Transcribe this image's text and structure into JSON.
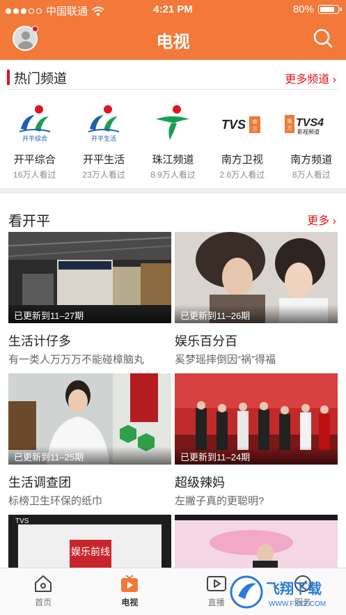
{
  "status": {
    "carrier": "中国联通",
    "time": "4:21 PM",
    "battery": "80%"
  },
  "header": {
    "title": "电视"
  },
  "hot": {
    "title": "热门频道",
    "more": "更多频道",
    "channels": [
      {
        "name": "开平综合",
        "views": "16万人看过",
        "logo_text": "开平综合",
        "icon": "kaiping-logo"
      },
      {
        "name": "开平生活",
        "views": "23万人看过",
        "logo_text": "开平生活",
        "icon": "kaiping-logo"
      },
      {
        "name": "珠江频道",
        "views": "8.9万人看过",
        "logo_text": "",
        "icon": "zhujiang-logo"
      },
      {
        "name": "南方卫视",
        "views": "2.6万人看过",
        "logo_text": "TVS",
        "logo_side": "南方",
        "icon": "tvs-logo"
      },
      {
        "name": "南方频道",
        "views": "8万人看过",
        "logo_text": "TVS4",
        "logo_side": "南方",
        "logo_sub": "影视频道",
        "icon": "tvs4-logo"
      }
    ]
  },
  "kaiping": {
    "title": "看开平",
    "more": "更多",
    "items": [
      {
        "update": "已更新到11–27期",
        "title": "生活计仔多",
        "subtitle": "有一类人万万万不能碰樟脑丸"
      },
      {
        "update": "已更新到11–26期",
        "title": "娱乐百分百",
        "subtitle": "奚梦瑶摔倒因“祸”得福"
      },
      {
        "update": "已更新到11–25期",
        "title": "生活调查团",
        "subtitle": "标榜卫生环保的纸巾"
      },
      {
        "update": "已更新到11–24期",
        "title": "超级辣妈",
        "subtitle": "左撇子真的更聪明?"
      }
    ],
    "partial_thumbs": [
      {
        "overlay_text": "娱乐前线",
        "corner_text": "TVS"
      },
      {
        "overlay_text": "",
        "corner_text": ""
      }
    ]
  },
  "tabs": [
    {
      "label": "首页",
      "icon": "home-icon"
    },
    {
      "label": "电视",
      "icon": "tv-icon"
    },
    {
      "label": "直播",
      "icon": "live-icon"
    },
    {
      "label": "服务",
      "icon": "service-icon"
    }
  ],
  "watermark": {
    "brand": "飞翔下载",
    "url": "WWW.FXXZ.COM"
  },
  "colors": {
    "accent": "#f2793a",
    "red": "#e0161b"
  }
}
